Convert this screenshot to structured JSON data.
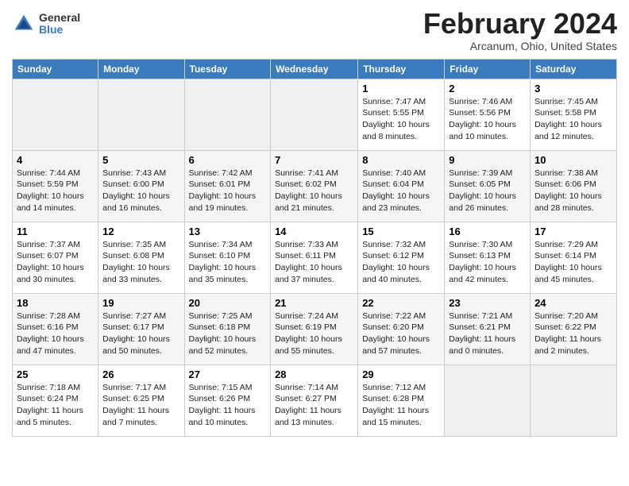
{
  "header": {
    "logo_general": "General",
    "logo_blue": "Blue",
    "month_title": "February 2024",
    "location": "Arcanum, Ohio, United States"
  },
  "columns": [
    "Sunday",
    "Monday",
    "Tuesday",
    "Wednesday",
    "Thursday",
    "Friday",
    "Saturday"
  ],
  "weeks": [
    [
      {
        "day": "",
        "sunrise": "",
        "sunset": "",
        "daylight": ""
      },
      {
        "day": "",
        "sunrise": "",
        "sunset": "",
        "daylight": ""
      },
      {
        "day": "",
        "sunrise": "",
        "sunset": "",
        "daylight": ""
      },
      {
        "day": "",
        "sunrise": "",
        "sunset": "",
        "daylight": ""
      },
      {
        "day": "1",
        "sunrise": "Sunrise: 7:47 AM",
        "sunset": "Sunset: 5:55 PM",
        "daylight": "Daylight: 10 hours and 8 minutes."
      },
      {
        "day": "2",
        "sunrise": "Sunrise: 7:46 AM",
        "sunset": "Sunset: 5:56 PM",
        "daylight": "Daylight: 10 hours and 10 minutes."
      },
      {
        "day": "3",
        "sunrise": "Sunrise: 7:45 AM",
        "sunset": "Sunset: 5:58 PM",
        "daylight": "Daylight: 10 hours and 12 minutes."
      }
    ],
    [
      {
        "day": "4",
        "sunrise": "Sunrise: 7:44 AM",
        "sunset": "Sunset: 5:59 PM",
        "daylight": "Daylight: 10 hours and 14 minutes."
      },
      {
        "day": "5",
        "sunrise": "Sunrise: 7:43 AM",
        "sunset": "Sunset: 6:00 PM",
        "daylight": "Daylight: 10 hours and 16 minutes."
      },
      {
        "day": "6",
        "sunrise": "Sunrise: 7:42 AM",
        "sunset": "Sunset: 6:01 PM",
        "daylight": "Daylight: 10 hours and 19 minutes."
      },
      {
        "day": "7",
        "sunrise": "Sunrise: 7:41 AM",
        "sunset": "Sunset: 6:02 PM",
        "daylight": "Daylight: 10 hours and 21 minutes."
      },
      {
        "day": "8",
        "sunrise": "Sunrise: 7:40 AM",
        "sunset": "Sunset: 6:04 PM",
        "daylight": "Daylight: 10 hours and 23 minutes."
      },
      {
        "day": "9",
        "sunrise": "Sunrise: 7:39 AM",
        "sunset": "Sunset: 6:05 PM",
        "daylight": "Daylight: 10 hours and 26 minutes."
      },
      {
        "day": "10",
        "sunrise": "Sunrise: 7:38 AM",
        "sunset": "Sunset: 6:06 PM",
        "daylight": "Daylight: 10 hours and 28 minutes."
      }
    ],
    [
      {
        "day": "11",
        "sunrise": "Sunrise: 7:37 AM",
        "sunset": "Sunset: 6:07 PM",
        "daylight": "Daylight: 10 hours and 30 minutes."
      },
      {
        "day": "12",
        "sunrise": "Sunrise: 7:35 AM",
        "sunset": "Sunset: 6:08 PM",
        "daylight": "Daylight: 10 hours and 33 minutes."
      },
      {
        "day": "13",
        "sunrise": "Sunrise: 7:34 AM",
        "sunset": "Sunset: 6:10 PM",
        "daylight": "Daylight: 10 hours and 35 minutes."
      },
      {
        "day": "14",
        "sunrise": "Sunrise: 7:33 AM",
        "sunset": "Sunset: 6:11 PM",
        "daylight": "Daylight: 10 hours and 37 minutes."
      },
      {
        "day": "15",
        "sunrise": "Sunrise: 7:32 AM",
        "sunset": "Sunset: 6:12 PM",
        "daylight": "Daylight: 10 hours and 40 minutes."
      },
      {
        "day": "16",
        "sunrise": "Sunrise: 7:30 AM",
        "sunset": "Sunset: 6:13 PM",
        "daylight": "Daylight: 10 hours and 42 minutes."
      },
      {
        "day": "17",
        "sunrise": "Sunrise: 7:29 AM",
        "sunset": "Sunset: 6:14 PM",
        "daylight": "Daylight: 10 hours and 45 minutes."
      }
    ],
    [
      {
        "day": "18",
        "sunrise": "Sunrise: 7:28 AM",
        "sunset": "Sunset: 6:16 PM",
        "daylight": "Daylight: 10 hours and 47 minutes."
      },
      {
        "day": "19",
        "sunrise": "Sunrise: 7:27 AM",
        "sunset": "Sunset: 6:17 PM",
        "daylight": "Daylight: 10 hours and 50 minutes."
      },
      {
        "day": "20",
        "sunrise": "Sunrise: 7:25 AM",
        "sunset": "Sunset: 6:18 PM",
        "daylight": "Daylight: 10 hours and 52 minutes."
      },
      {
        "day": "21",
        "sunrise": "Sunrise: 7:24 AM",
        "sunset": "Sunset: 6:19 PM",
        "daylight": "Daylight: 10 hours and 55 minutes."
      },
      {
        "day": "22",
        "sunrise": "Sunrise: 7:22 AM",
        "sunset": "Sunset: 6:20 PM",
        "daylight": "Daylight: 10 hours and 57 minutes."
      },
      {
        "day": "23",
        "sunrise": "Sunrise: 7:21 AM",
        "sunset": "Sunset: 6:21 PM",
        "daylight": "Daylight: 11 hours and 0 minutes."
      },
      {
        "day": "24",
        "sunrise": "Sunrise: 7:20 AM",
        "sunset": "Sunset: 6:22 PM",
        "daylight": "Daylight: 11 hours and 2 minutes."
      }
    ],
    [
      {
        "day": "25",
        "sunrise": "Sunrise: 7:18 AM",
        "sunset": "Sunset: 6:24 PM",
        "daylight": "Daylight: 11 hours and 5 minutes."
      },
      {
        "day": "26",
        "sunrise": "Sunrise: 7:17 AM",
        "sunset": "Sunset: 6:25 PM",
        "daylight": "Daylight: 11 hours and 7 minutes."
      },
      {
        "day": "27",
        "sunrise": "Sunrise: 7:15 AM",
        "sunset": "Sunset: 6:26 PM",
        "daylight": "Daylight: 11 hours and 10 minutes."
      },
      {
        "day": "28",
        "sunrise": "Sunrise: 7:14 AM",
        "sunset": "Sunset: 6:27 PM",
        "daylight": "Daylight: 11 hours and 13 minutes."
      },
      {
        "day": "29",
        "sunrise": "Sunrise: 7:12 AM",
        "sunset": "Sunset: 6:28 PM",
        "daylight": "Daylight: 11 hours and 15 minutes."
      },
      {
        "day": "",
        "sunrise": "",
        "sunset": "",
        "daylight": ""
      },
      {
        "day": "",
        "sunrise": "",
        "sunset": "",
        "daylight": ""
      }
    ]
  ]
}
